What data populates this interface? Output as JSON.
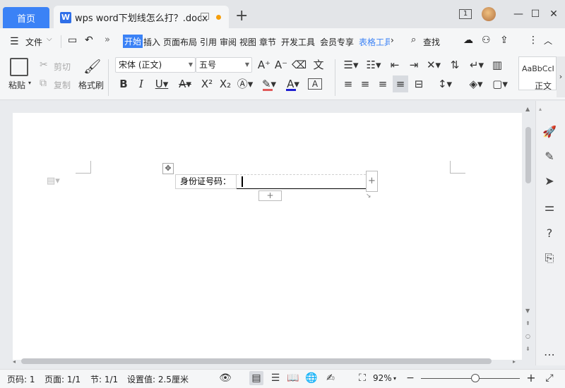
{
  "titlebar": {
    "home_tab": "首页",
    "doc_tab_title": "wps word下划线怎么打？.docx",
    "doc_tab_icon": "W",
    "new_tab": "+",
    "page_indicator": "1"
  },
  "menu": {
    "file": "文件",
    "items": [
      "开始",
      "插入",
      "页面布局",
      "引用",
      "审阅",
      "视图",
      "章节",
      "开发工具",
      "会员专享",
      "表格工具"
    ],
    "search": "查找"
  },
  "ribbon": {
    "paste": "粘贴",
    "cut": "剪切",
    "copy": "复制",
    "format_painter": "格式刷",
    "font_name": "宋体 (正文)",
    "font_size": "五号",
    "style_preview": "AaBbCcI",
    "style_name": "正文"
  },
  "document": {
    "label": "身份证号码：",
    "input_value": ""
  },
  "status": {
    "page_num": "页码: 1",
    "pages": "页面: 1/1",
    "section": "节: 1/1",
    "setting": "设置值: 2.5厘米",
    "zoom": "92%",
    "zoom_level": 0.55
  },
  "colors": {
    "accent": "#3b82f6",
    "font_color": "#1f1fd1",
    "highlight": "#e05a5a"
  }
}
